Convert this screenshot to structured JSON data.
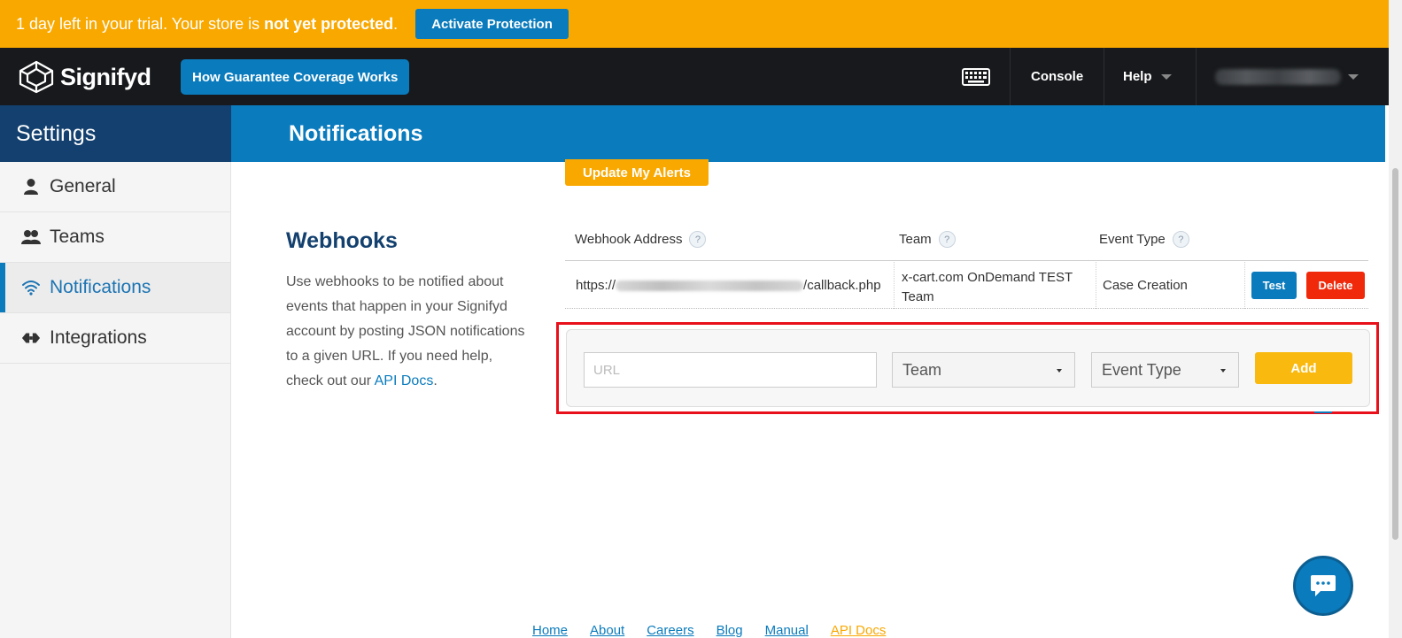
{
  "banner": {
    "text_prefix": "1 day left in your trial. Your store is ",
    "text_bold": "not yet protected",
    "text_suffix": ".",
    "activate_label": "Activate Protection"
  },
  "nav": {
    "brand": "Signifyd",
    "coverage_label": "How Guarantee Coverage Works",
    "console_label": "Console",
    "help_label": "Help"
  },
  "sidebar": {
    "title": "Settings",
    "items": [
      {
        "label": "General",
        "icon": "user-icon"
      },
      {
        "label": "Teams",
        "icon": "users-icon"
      },
      {
        "label": "Notifications",
        "icon": "wifi-icon",
        "active": true
      },
      {
        "label": "Integrations",
        "icon": "plug-icon"
      }
    ]
  },
  "page": {
    "title": "Notifications",
    "update_alerts_label": "Update My Alerts"
  },
  "webhooks": {
    "title": "Webhooks",
    "description": "Use webhooks to be notified about events that happen in your Signifyd account by posting JSON notifications to a given URL. If you need help, check out our ",
    "api_docs_link": "API Docs",
    "description_end": ".",
    "columns": [
      "Webhook Address",
      "Team",
      "Event Type"
    ],
    "help_glyph": "?",
    "rows": [
      {
        "address_prefix": "https://",
        "address_suffix": "/callback.php",
        "team": "x-cart.com OnDemand TEST Team",
        "event_type": "Case Creation",
        "test_label": "Test",
        "delete_label": "Delete"
      }
    ],
    "add_form": {
      "url_placeholder": "URL",
      "url_value": "",
      "team_select": "Team",
      "event_select": "Event Type",
      "add_label": "Add"
    }
  },
  "footer": {
    "links": [
      "Home",
      "About",
      "Careers",
      "Blog",
      "Manual",
      "API Docs"
    ]
  },
  "colors": {
    "banner": "#f9a800",
    "primary": "#0a7bbd",
    "navy": "#13406e",
    "danger": "#f0290b",
    "highlight": "#e8101a"
  }
}
